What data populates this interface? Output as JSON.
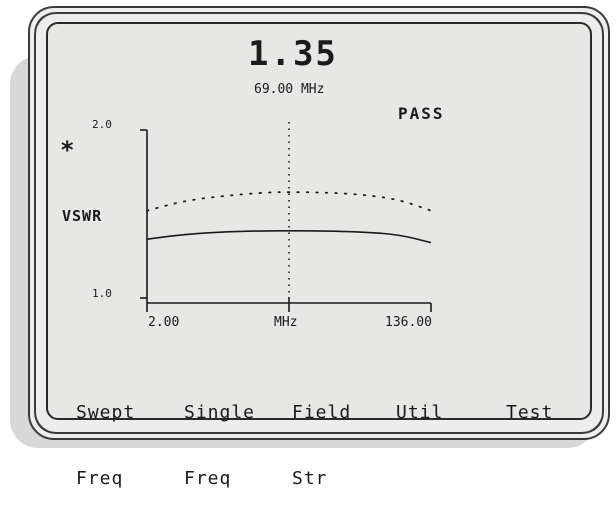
{
  "readout": {
    "value": "1.35",
    "frequency": "69.00 MHz",
    "status": "PASS",
    "marker": "*"
  },
  "chart_data": {
    "type": "line",
    "ylabel": "VSWR",
    "xlabel": "MHz",
    "ylim": [
      1.0,
      2.0
    ],
    "xlim": [
      2.0,
      136.0
    ],
    "y_tick_labels": [
      "2.0",
      "1.0"
    ],
    "x_tick_labels": [
      "2.00",
      "MHz",
      "136.00"
    ],
    "marker_x": 69.0,
    "series": [
      {
        "style": "dotted",
        "x": [
          2,
          20,
          40,
          60,
          69,
          80,
          100,
          120,
          136
        ],
        "y": [
          1.52,
          1.58,
          1.61,
          1.63,
          1.63,
          1.63,
          1.62,
          1.59,
          1.52
        ]
      },
      {
        "style": "solid",
        "x": [
          2,
          20,
          40,
          60,
          69,
          80,
          100,
          120,
          136
        ],
        "y": [
          1.35,
          1.38,
          1.395,
          1.4,
          1.4,
          1.4,
          1.395,
          1.38,
          1.33
        ]
      }
    ]
  },
  "menu": [
    {
      "line1": "Swept",
      "line2": "Freq"
    },
    {
      "line1": "Single",
      "line2": "Freq"
    },
    {
      "line1": "Field",
      "line2": "Str"
    },
    {
      "line1": "Util",
      "line2": ""
    },
    {
      "line1": "Test",
      "line2": ""
    }
  ]
}
